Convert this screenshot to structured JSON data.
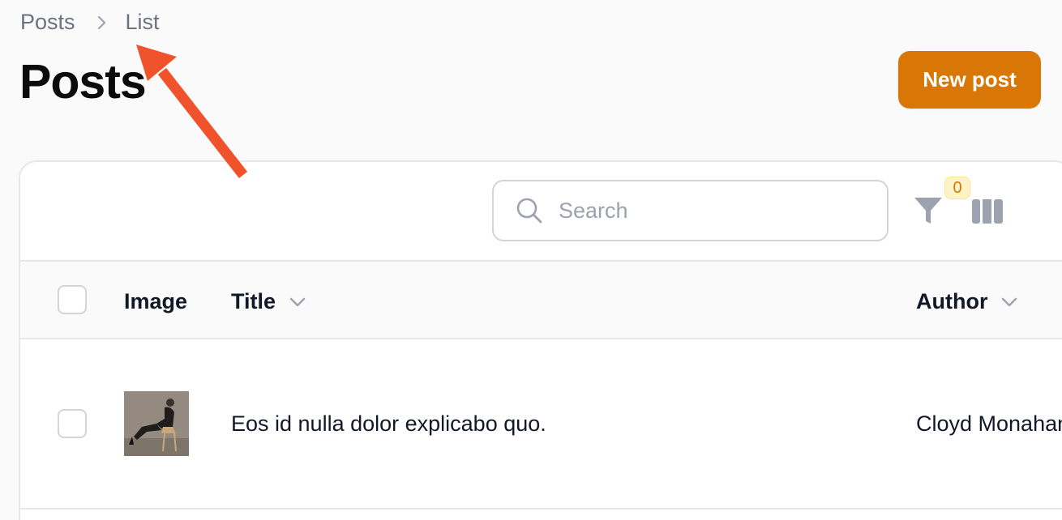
{
  "breadcrumb": {
    "items": [
      "Posts",
      "List"
    ]
  },
  "header": {
    "title": "Posts",
    "new_button": "New post"
  },
  "toolbar": {
    "search_placeholder": "Search",
    "filter_count": "0"
  },
  "table": {
    "columns": {
      "image": "Image",
      "title": "Title",
      "author": "Author"
    },
    "rows": [
      {
        "title": "Eos id nulla dolor explicabo quo.",
        "author": "Cloyd Monahan"
      }
    ]
  },
  "colors": {
    "accent": "#d97706",
    "annotation_arrow": "#f0522b"
  }
}
